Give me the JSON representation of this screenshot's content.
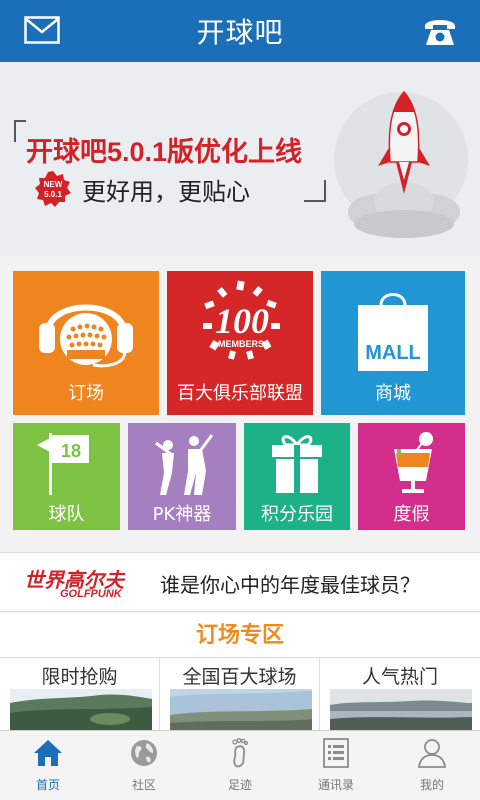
{
  "header": {
    "title": "开球吧",
    "left_icon": "mail-icon",
    "right_icon": "phone-icon"
  },
  "banner": {
    "headline": "开球吧5.0.1版优化上线",
    "badge_top": "NEW",
    "badge_bottom": "5.0.1",
    "subline": "更好用，更贴心"
  },
  "tiles": {
    "order": {
      "label": "订场",
      "icon": "golf-headset-icon"
    },
    "members": {
      "label": "百大俱乐部联盟",
      "icon_number": "100",
      "icon_text": "MEMBERS"
    },
    "mall": {
      "label": "商城",
      "icon_text": "MALL"
    },
    "team": {
      "label": "球队",
      "icon_number": "18"
    },
    "pk": {
      "label": "PK神器",
      "icon": "golfer-icon"
    },
    "points": {
      "label": "积分乐园",
      "icon": "gift-icon"
    },
    "holiday": {
      "label": "度假",
      "icon": "cocktail-icon"
    }
  },
  "promo": {
    "brand_cn": "世界高尔夫",
    "brand_en": "GOLFPUNK",
    "question": "谁是你心中的年度最佳球员？"
  },
  "section": {
    "title": "订场专区"
  },
  "features": [
    {
      "label": "限时抢购"
    },
    {
      "label": "全国百大球场"
    },
    {
      "label": "人气热门"
    }
  ],
  "tabbar": [
    {
      "label": "首页",
      "icon": "home-icon",
      "active": true
    },
    {
      "label": "社区",
      "icon": "globe-icon",
      "active": false
    },
    {
      "label": "足迹",
      "icon": "footprint-icon",
      "active": false
    },
    {
      "label": "通讯录",
      "icon": "contacts-icon",
      "active": false
    },
    {
      "label": "我的",
      "icon": "profile-icon",
      "active": false
    }
  ],
  "colors": {
    "header": "#1a6fb8",
    "order": "#f0841e",
    "members": "#d62728",
    "mall": "#2196d3",
    "team": "#7dc243",
    "pk": "#a67fc1",
    "points": "#1db18a",
    "holiday": "#d32e8b"
  }
}
